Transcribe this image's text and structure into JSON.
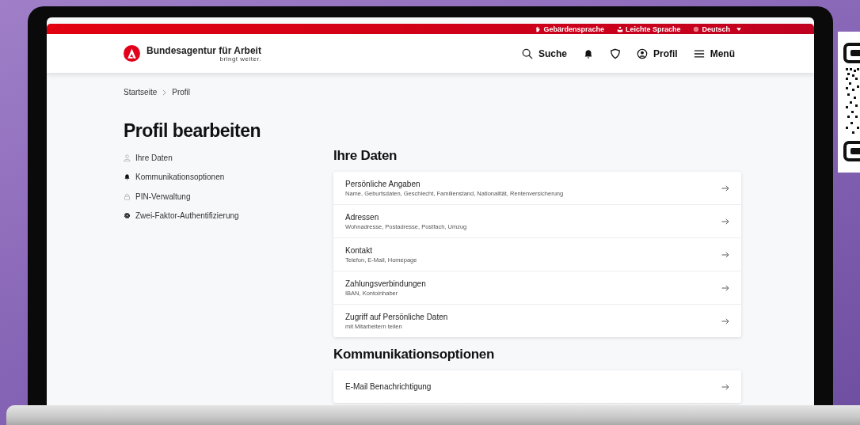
{
  "top_bar": {
    "links": [
      {
        "kind": "hand",
        "label": "Gebärdensprache"
      },
      {
        "kind": "easy",
        "label": "Leichte Sprache"
      },
      {
        "kind": "language",
        "label": "Deutsch"
      }
    ]
  },
  "header": {
    "brand": "Bundesagentur für Arbeit",
    "tagline": "bringt weiter.",
    "nav": [
      {
        "kind": "search",
        "label": "Suche"
      },
      {
        "kind": "bell"
      },
      {
        "kind": "shield"
      },
      {
        "kind": "profile",
        "label": "Profil"
      },
      {
        "kind": "menu",
        "label": "Menü"
      }
    ]
  },
  "breadcrumb": [
    "Startseite",
    "Profil"
  ],
  "page_title": "Profil bearbeiten",
  "sidebar": {
    "items": [
      {
        "kind": "person",
        "label": "Ihre Daten"
      },
      {
        "kind": "bell",
        "label": "Kommunikationsoptionen"
      },
      {
        "kind": "lock",
        "label": "PIN-Verwaltung"
      },
      {
        "kind": "gear",
        "label": "Zwei-Faktor-Authentifizierung"
      }
    ]
  },
  "sections": [
    {
      "title": "Ihre Daten",
      "items": [
        {
          "title": "Persönliche Angaben",
          "subtitle": "Name, Geburtsdaten, Geschlecht, Familienstand, Nationalität, Rentenversicherung"
        },
        {
          "title": "Adressen",
          "subtitle": "Wohnadresse, Postadresse, Postfach, Umzug"
        },
        {
          "title": "Kontakt",
          "subtitle": "Telefon, E-Mail, Homepage"
        },
        {
          "title": "Zahlungsverbindungen",
          "subtitle": "IBAN, Kontoinhaber"
        },
        {
          "title": "Zugriff auf Persönliche Daten",
          "subtitle": "mit Mitarbeitern teilen"
        }
      ]
    },
    {
      "title": "Kommunikationsoptionen",
      "items": [
        {
          "title": "E-Mail Benachrichtigung"
        }
      ]
    }
  ]
}
